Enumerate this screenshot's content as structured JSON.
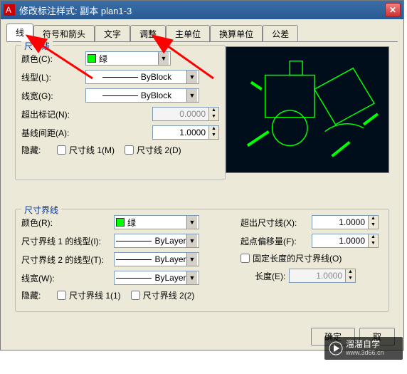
{
  "window": {
    "title": "修改标注样式: 副本 plan1-3"
  },
  "tabs": [
    "线",
    "符号和箭头",
    "文字",
    "调整",
    "主单位",
    "换算单位",
    "公差"
  ],
  "active_tab": 0,
  "dimline": {
    "legend": "尺寸线",
    "color_label": "颜色(C):",
    "color_value": "绿",
    "linetype_label": "线型(L):",
    "linetype_value": "ByBlock",
    "lineweight_label": "线宽(G):",
    "lineweight_value": "ByBlock",
    "ext_label": "超出标记(N):",
    "ext_value": "0.0000",
    "baseline_label": "基线间距(A):",
    "baseline_value": "1.0000",
    "hide_label": "隐藏:",
    "hide1": "尺寸线 1(M)",
    "hide2": "尺寸线 2(D)"
  },
  "extline": {
    "legend": "尺寸界线",
    "color_label": "颜色(R):",
    "color_value": "绿",
    "lt1_label": "尺寸界线 1 的线型(I):",
    "lt1_value": "ByLayer",
    "lt2_label": "尺寸界线 2 的线型(T):",
    "lt2_value": "ByLayer",
    "lw_label": "线宽(W):",
    "lw_value": "ByLayer",
    "hide_label": "隐藏:",
    "hide1": "尺寸界线 1(1)",
    "hide2": "尺寸界线 2(2)",
    "beyond_label": "超出尺寸线(X):",
    "beyond_value": "1.0000",
    "offset_label": "起点偏移量(F):",
    "offset_value": "1.0000",
    "fixed_chk": "固定长度的尺寸界线(O)",
    "length_label": "长度(E):",
    "length_value": "1.0000"
  },
  "buttons": {
    "ok": "确定",
    "cancel": "取"
  },
  "watermark": {
    "brand": "溜溜自学",
    "url": "www.3d66.cn"
  }
}
